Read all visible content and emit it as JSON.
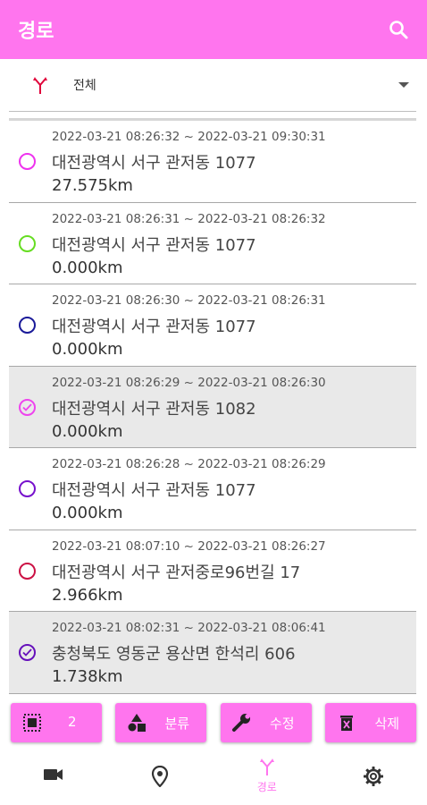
{
  "appbar": {
    "title": "경로",
    "search_icon": "search-icon",
    "color": "#ff75ee"
  },
  "filter": {
    "icon": "route-icon",
    "label": "전체"
  },
  "routes": [
    {
      "time": "2022-03-21 08:26:32 ~ 2022-03-21 09:30:31",
      "address": "대전광역시 서구 관저동 1077",
      "distance": "27.575km",
      "color": "#ee33ee",
      "selected": false
    },
    {
      "time": "2022-03-21 08:26:31 ~ 2022-03-21 08:26:32",
      "address": "대전광역시 서구 관저동 1077",
      "distance": "0.000km",
      "color": "#66dd22",
      "selected": false
    },
    {
      "time": "2022-03-21 08:26:30 ~ 2022-03-21 08:26:31",
      "address": "대전광역시 서구 관저동 1077",
      "distance": "0.000km",
      "color": "#1a1a99",
      "selected": false
    },
    {
      "time": "2022-03-21 08:26:29 ~ 2022-03-21 08:26:30",
      "address": "대전광역시 서구 관저동 1082",
      "distance": "0.000km",
      "color": "#ee44ee",
      "selected": true
    },
    {
      "time": "2022-03-21 08:26:28 ~ 2022-03-21 08:26:29",
      "address": "대전광역시 서구 관저동 1077",
      "distance": "0.000km",
      "color": "#7711cc",
      "selected": false
    },
    {
      "time": "2022-03-21 08:07:10 ~ 2022-03-21 08:26:27",
      "address": "대전광역시 서구 관저중로96번길 17",
      "distance": "2.966km",
      "color": "#cc1144",
      "selected": false
    },
    {
      "time": "2022-03-21 08:02:31 ~ 2022-03-21 08:06:41",
      "address": "충청북도 영동군 용산면 한석리 606",
      "distance": "1.738km",
      "color": "#6611bb",
      "selected": true
    }
  ],
  "actions": {
    "select": {
      "icon": "select-all-icon",
      "label": "2"
    },
    "category": {
      "icon": "category-icon",
      "label": "분류"
    },
    "edit": {
      "icon": "wrench-icon",
      "label": "수정"
    },
    "delete": {
      "icon": "trash-icon",
      "label": "삭제"
    }
  },
  "bottom_nav": [
    {
      "icon": "video-icon",
      "label": ""
    },
    {
      "icon": "location-pin-icon",
      "label": ""
    },
    {
      "icon": "route-icon",
      "label": "경로",
      "active": true
    },
    {
      "icon": "gear-icon",
      "label": ""
    }
  ]
}
